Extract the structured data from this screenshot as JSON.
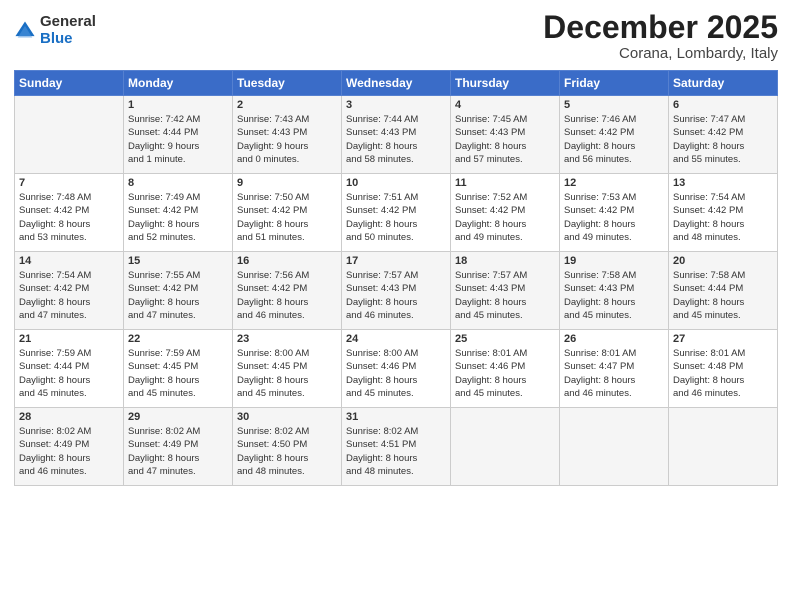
{
  "logo": {
    "general": "General",
    "blue": "Blue"
  },
  "title": "December 2025",
  "subtitle": "Corana, Lombardy, Italy",
  "days_header": [
    "Sunday",
    "Monday",
    "Tuesday",
    "Wednesday",
    "Thursday",
    "Friday",
    "Saturday"
  ],
  "weeks": [
    [
      {
        "day": "",
        "info": ""
      },
      {
        "day": "1",
        "info": "Sunrise: 7:42 AM\nSunset: 4:44 PM\nDaylight: 9 hours\nand 1 minute."
      },
      {
        "day": "2",
        "info": "Sunrise: 7:43 AM\nSunset: 4:43 PM\nDaylight: 9 hours\nand 0 minutes."
      },
      {
        "day": "3",
        "info": "Sunrise: 7:44 AM\nSunset: 4:43 PM\nDaylight: 8 hours\nand 58 minutes."
      },
      {
        "day": "4",
        "info": "Sunrise: 7:45 AM\nSunset: 4:43 PM\nDaylight: 8 hours\nand 57 minutes."
      },
      {
        "day": "5",
        "info": "Sunrise: 7:46 AM\nSunset: 4:42 PM\nDaylight: 8 hours\nand 56 minutes."
      },
      {
        "day": "6",
        "info": "Sunrise: 7:47 AM\nSunset: 4:42 PM\nDaylight: 8 hours\nand 55 minutes."
      }
    ],
    [
      {
        "day": "7",
        "info": "Sunrise: 7:48 AM\nSunset: 4:42 PM\nDaylight: 8 hours\nand 53 minutes."
      },
      {
        "day": "8",
        "info": "Sunrise: 7:49 AM\nSunset: 4:42 PM\nDaylight: 8 hours\nand 52 minutes."
      },
      {
        "day": "9",
        "info": "Sunrise: 7:50 AM\nSunset: 4:42 PM\nDaylight: 8 hours\nand 51 minutes."
      },
      {
        "day": "10",
        "info": "Sunrise: 7:51 AM\nSunset: 4:42 PM\nDaylight: 8 hours\nand 50 minutes."
      },
      {
        "day": "11",
        "info": "Sunrise: 7:52 AM\nSunset: 4:42 PM\nDaylight: 8 hours\nand 49 minutes."
      },
      {
        "day": "12",
        "info": "Sunrise: 7:53 AM\nSunset: 4:42 PM\nDaylight: 8 hours\nand 49 minutes."
      },
      {
        "day": "13",
        "info": "Sunrise: 7:54 AM\nSunset: 4:42 PM\nDaylight: 8 hours\nand 48 minutes."
      }
    ],
    [
      {
        "day": "14",
        "info": "Sunrise: 7:54 AM\nSunset: 4:42 PM\nDaylight: 8 hours\nand 47 minutes."
      },
      {
        "day": "15",
        "info": "Sunrise: 7:55 AM\nSunset: 4:42 PM\nDaylight: 8 hours\nand 47 minutes."
      },
      {
        "day": "16",
        "info": "Sunrise: 7:56 AM\nSunset: 4:42 PM\nDaylight: 8 hours\nand 46 minutes."
      },
      {
        "day": "17",
        "info": "Sunrise: 7:57 AM\nSunset: 4:43 PM\nDaylight: 8 hours\nand 46 minutes."
      },
      {
        "day": "18",
        "info": "Sunrise: 7:57 AM\nSunset: 4:43 PM\nDaylight: 8 hours\nand 45 minutes."
      },
      {
        "day": "19",
        "info": "Sunrise: 7:58 AM\nSunset: 4:43 PM\nDaylight: 8 hours\nand 45 minutes."
      },
      {
        "day": "20",
        "info": "Sunrise: 7:58 AM\nSunset: 4:44 PM\nDaylight: 8 hours\nand 45 minutes."
      }
    ],
    [
      {
        "day": "21",
        "info": "Sunrise: 7:59 AM\nSunset: 4:44 PM\nDaylight: 8 hours\nand 45 minutes."
      },
      {
        "day": "22",
        "info": "Sunrise: 7:59 AM\nSunset: 4:45 PM\nDaylight: 8 hours\nand 45 minutes."
      },
      {
        "day": "23",
        "info": "Sunrise: 8:00 AM\nSunset: 4:45 PM\nDaylight: 8 hours\nand 45 minutes."
      },
      {
        "day": "24",
        "info": "Sunrise: 8:00 AM\nSunset: 4:46 PM\nDaylight: 8 hours\nand 45 minutes."
      },
      {
        "day": "25",
        "info": "Sunrise: 8:01 AM\nSunset: 4:46 PM\nDaylight: 8 hours\nand 45 minutes."
      },
      {
        "day": "26",
        "info": "Sunrise: 8:01 AM\nSunset: 4:47 PM\nDaylight: 8 hours\nand 46 minutes."
      },
      {
        "day": "27",
        "info": "Sunrise: 8:01 AM\nSunset: 4:48 PM\nDaylight: 8 hours\nand 46 minutes."
      }
    ],
    [
      {
        "day": "28",
        "info": "Sunrise: 8:02 AM\nSunset: 4:49 PM\nDaylight: 8 hours\nand 46 minutes."
      },
      {
        "day": "29",
        "info": "Sunrise: 8:02 AM\nSunset: 4:49 PM\nDaylight: 8 hours\nand 47 minutes."
      },
      {
        "day": "30",
        "info": "Sunrise: 8:02 AM\nSunset: 4:50 PM\nDaylight: 8 hours\nand 48 minutes."
      },
      {
        "day": "31",
        "info": "Sunrise: 8:02 AM\nSunset: 4:51 PM\nDaylight: 8 hours\nand 48 minutes."
      },
      {
        "day": "",
        "info": ""
      },
      {
        "day": "",
        "info": ""
      },
      {
        "day": "",
        "info": ""
      }
    ]
  ]
}
